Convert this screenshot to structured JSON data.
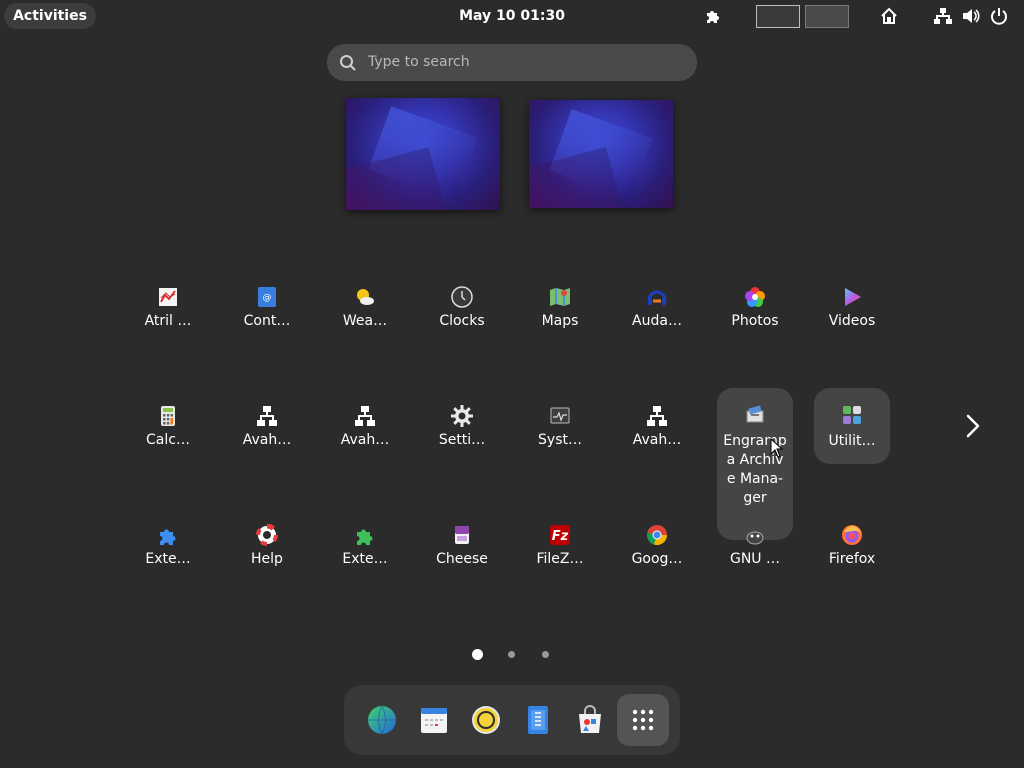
{
  "topbar": {
    "activities_label": "Activities",
    "clock": "May 10  01:30",
    "icons": [
      "extensions-icon",
      "home-icon",
      "network-icon",
      "volume-icon",
      "power-icon"
    ],
    "workspaces": [
      "workspace-1",
      "workspace-2"
    ]
  },
  "search": {
    "placeholder": "Type to search"
  },
  "apps": {
    "row1": [
      {
        "label": "Atril …",
        "icon": "atril-document-viewer-icon"
      },
      {
        "label": "Cont…",
        "icon": "contacts-icon"
      },
      {
        "label": "Wea…",
        "icon": "weather-icon"
      },
      {
        "label": "Clocks",
        "icon": "clocks-icon"
      },
      {
        "label": "Maps",
        "icon": "maps-icon"
      },
      {
        "label": "Auda…",
        "icon": "audacity-icon"
      },
      {
        "label": "Photos",
        "icon": "photos-icon"
      },
      {
        "label": "Videos",
        "icon": "videos-icon"
      }
    ],
    "row2": [
      {
        "label": "Calc…",
        "icon": "calculator-icon"
      },
      {
        "label": "Avah…",
        "icon": "avahi-network-icon"
      },
      {
        "label": "Avah…",
        "icon": "avahi-network-icon"
      },
      {
        "label": "Setti…",
        "icon": "settings-icon"
      },
      {
        "label": "Syst…",
        "icon": "system-monitor-icon"
      },
      {
        "label": "Avah…",
        "icon": "avahi-network-icon"
      },
      {
        "label": "Engrampa Archive Mana-ger",
        "icon": "engrampa-archive-icon"
      },
      {
        "label": "Utilit…",
        "icon": "utilities-folder-icon"
      }
    ],
    "row3": [
      {
        "label": "Exte…",
        "icon": "extensions-puzzle-icon"
      },
      {
        "label": "Help",
        "icon": "help-lifebuoy-icon"
      },
      {
        "label": "Exte…",
        "icon": "extension-manager-icon"
      },
      {
        "label": "Cheese",
        "icon": "cheese-icon"
      },
      {
        "label": "FileZ…",
        "icon": "filezilla-icon"
      },
      {
        "label": "Goog…",
        "icon": "google-chrome-icon"
      },
      {
        "label": "GNU …",
        "icon": "gnu-icon"
      },
      {
        "label": "Firefox",
        "icon": "firefox-icon"
      }
    ]
  },
  "pagination": {
    "current": 1,
    "total": 3
  },
  "dock": [
    {
      "name": "web-browser-icon"
    },
    {
      "name": "calendar-icon"
    },
    {
      "name": "rhythmbox-icon"
    },
    {
      "name": "text-editor-icon"
    },
    {
      "name": "software-center-icon"
    },
    {
      "name": "show-apps-icon"
    }
  ],
  "colors": {
    "background": "#2b2b2b",
    "topbar_text": "#ffffff",
    "dock": "#383838"
  }
}
